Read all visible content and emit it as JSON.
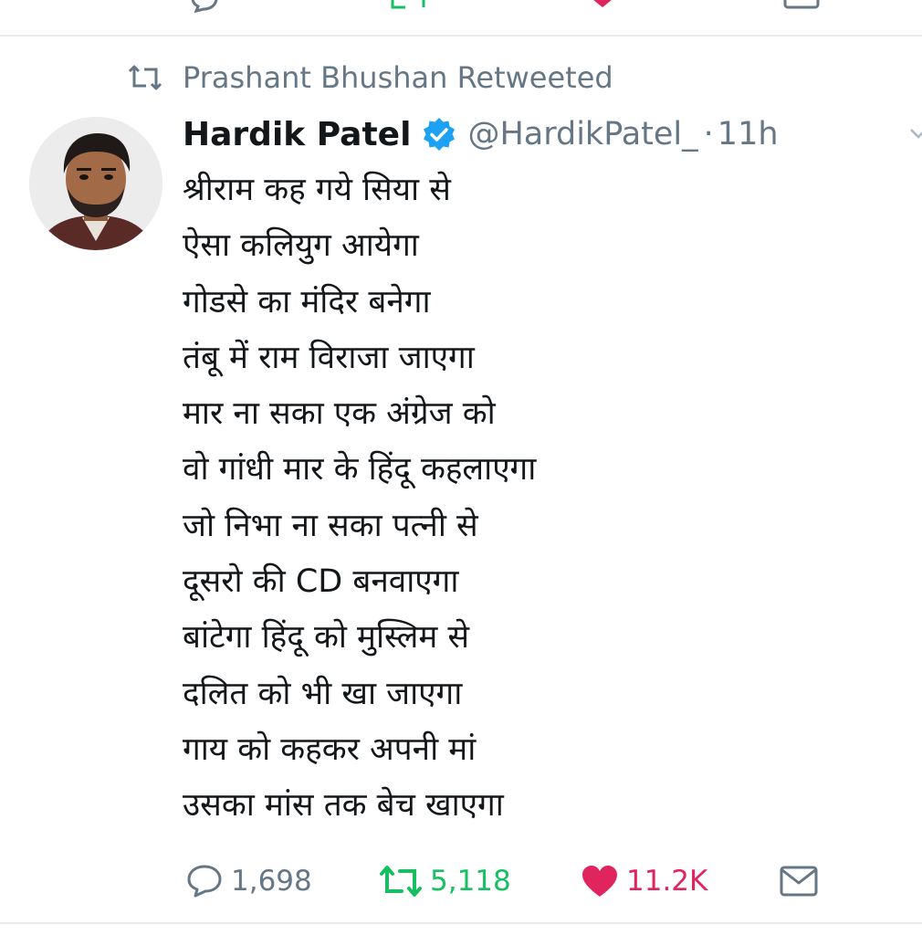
{
  "retweet_context": {
    "text": "Prashant Bhushan Retweeted"
  },
  "tweet": {
    "author": {
      "display_name": "Hardik Patel",
      "handle": "@HardikPatel_",
      "verified": true
    },
    "separator": "·",
    "time": "11h",
    "lines": [
      "श्रीराम कह गये सिया से",
      "ऐसा कलियुग आयेगा",
      "गोडसे का मंदिर बनेगा",
      "तंबू में राम विराजा जाएगा",
      "मार ना सका एक अंग्रेज को",
      "वो गांधी मार के हिंदू कहलाएगा",
      "जो निभा ना सका पत्नी से",
      "दूसरो की CD बनवाएगा",
      "बांटेगा हिंदू को मुस्लिम से",
      "दलित को भी खा जाएगा",
      "गाय को कहकर अपनी मां",
      "उसका मांस तक बेच खाएगा"
    ],
    "actions": {
      "replies": "1,698",
      "retweets": "5,118",
      "likes": "11.2K"
    }
  },
  "icons": {
    "retweet_context": "retweet-icon",
    "verified": "verified-badge-icon",
    "caret": "chevron-down-icon",
    "reply": "reply-icon",
    "retweet": "retweet-icon",
    "like": "heart-icon",
    "dm": "envelope-icon"
  },
  "colors": {
    "text_primary": "#14171a",
    "text_secondary": "#657786",
    "verified_blue": "#1da1f2",
    "retweet_green": "#17bf63",
    "like_red": "#e0245e",
    "divider": "#e6ecf0"
  }
}
